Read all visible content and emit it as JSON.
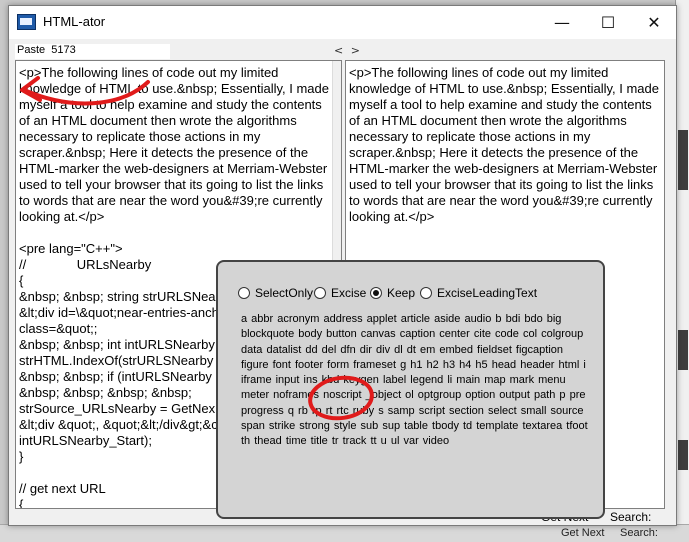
{
  "window": {
    "title": "HTML-ator",
    "controls": {
      "minimize": "—",
      "maximize": "☐",
      "close": "✕"
    }
  },
  "paste": {
    "label": "Paste",
    "count": "5173"
  },
  "nav": {
    "label": "< >"
  },
  "left_pane": {
    "text": "<p>The following lines of code out my limited knowledge of HTML to use.&nbsp; Essentially, I made myself a tool to help examine and study the contents of an HTML document then wrote the algorithms necessary to replicate those actions in my scraper.&nbsp; Here it detects the presence of the HTML-marker the web-designers at Merriam-Webster used to tell your browser that its going to list the links to words that are near the word you&#39;re currently looking at.</p>\n\n<pre lang=\"C++\">\n//              URLsNearby\n{\n&nbsp; &nbsp; string strURLSNea\n&lt;div id=\\&quot;near-entries-anch\nclass=&quot;;\n&nbsp; &nbsp; int intURLSNearby\nstrHTML.IndexOf(strURLSNearby\n&nbsp; &nbsp; if (intURLSNearby\n&nbsp; &nbsp; &nbsp; &nbsp;\nstrSource_URLsNearby = GetNex\n&lt;div &quot;, &quot;&lt;/div&gt;&c\nintURLSNearby_Start);\n}\n\n// get next URL\n{"
  },
  "right_pane": {
    "text": "<p>The following lines of code out my limited knowledge of HTML to use.&nbsp; Essentially, I made myself a tool to help examine and study the contents of an HTML document then wrote the algorithms necessary to replicate those actions in my scraper.&nbsp; Here it detects the presence of the HTML-marker the web-designers at Merriam-Webster used to tell your browser that its going to list the links to words that are near the word you&#39;re currently looking at.</p>"
  },
  "popup": {
    "options": [
      {
        "label": "SelectOnly",
        "selected": false
      },
      {
        "label": "Excise",
        "selected": false
      },
      {
        "label": "Keep",
        "selected": true
      },
      {
        "label": "ExciseLeadingText",
        "selected": false
      }
    ],
    "tags": "a abbr acronym address applet article aside audio b bdi bdo big blockquote body button canvas caption center cite code col colgroup data datalist dd del dfn dir div dl dt em embed fieldset figcaption figure font footer form frameset g h1 h2 h3 h4 h5 head header html i iframe input ins kbd keygen label legend li main map mark menu meter noframes noscript _object ol optgroup option output path p pre progress q rb rp rt rtc ruby s samp script section select small source span strike strong style sub sup table tbody td template textarea tfoot th thead time title tr track tt u ul var video"
  },
  "footer": {
    "get_next": "Get Next",
    "search": "Search:"
  },
  "background": {
    "get_next": "Get Next",
    "search": "Search:"
  },
  "annotation_color": "#e01b1b"
}
